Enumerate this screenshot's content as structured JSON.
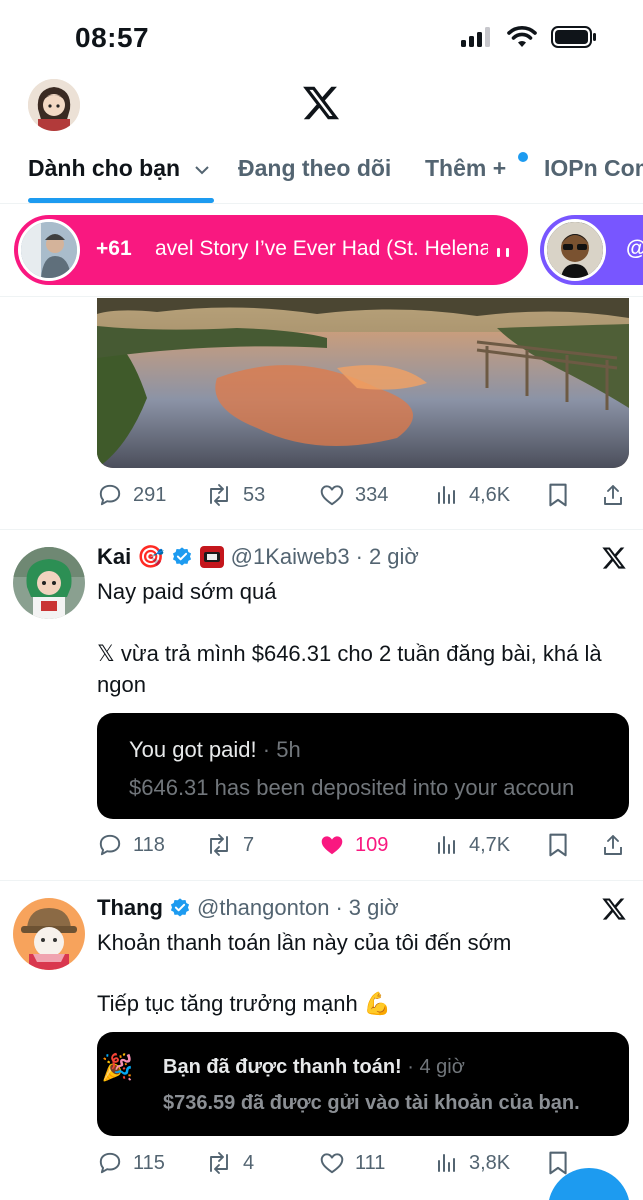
{
  "status_bar": {
    "time": "08:57"
  },
  "tabs": [
    {
      "label": "Dành cho bạn"
    },
    {
      "label": "Đang theo dõi"
    },
    {
      "label": "Thêm +"
    },
    {
      "label": "IOPn Com"
    }
  ],
  "spaces": {
    "live": {
      "count": "+61",
      "title": "avel Story I’ve Ever Had (St. Helena"
    },
    "next": {
      "title": "@"
    }
  },
  "tweets": [
    {
      "stats": {
        "replies": "291",
        "reposts": "53",
        "likes": "334",
        "views": "4,6K"
      }
    },
    {
      "name": "Kai",
      "name_emoji": "🎯",
      "handle": "@1Kaiweb3",
      "time": "2 giờ",
      "text_line1": "Nay paid sớm quá",
      "text_line2": "𝕏 vừa trả mình $646.31 cho 2 tuần đăng bài, khá là ngon",
      "card": {
        "title": "You got paid!",
        "time": "5h",
        "body": "$646.31 has been deposited into your accoun"
      },
      "stats": {
        "replies": "118",
        "reposts": "7",
        "likes": "109",
        "views": "4,7K"
      }
    },
    {
      "name": "Thang",
      "handle": "@thangonton",
      "time": "3 giờ",
      "text_line1": "Khoản thanh toán lần này của tôi đến sớm",
      "text_line2": "Tiếp tục tăng trưởng mạnh 💪",
      "card": {
        "icon": "🎉",
        "title": "Bạn đã được thanh toán!",
        "time": "4 giờ",
        "body": "$736.59 đã được gửi vào tài khoản của bạn."
      },
      "stats": {
        "replies": "115",
        "reposts": "4",
        "likes": "111",
        "views": "3,8K"
      }
    }
  ],
  "colors": {
    "accent": "#1d9bf0",
    "like": "#f91880",
    "space_live": "#f91880",
    "space_next": "#7856ff",
    "muted": "#536471"
  }
}
